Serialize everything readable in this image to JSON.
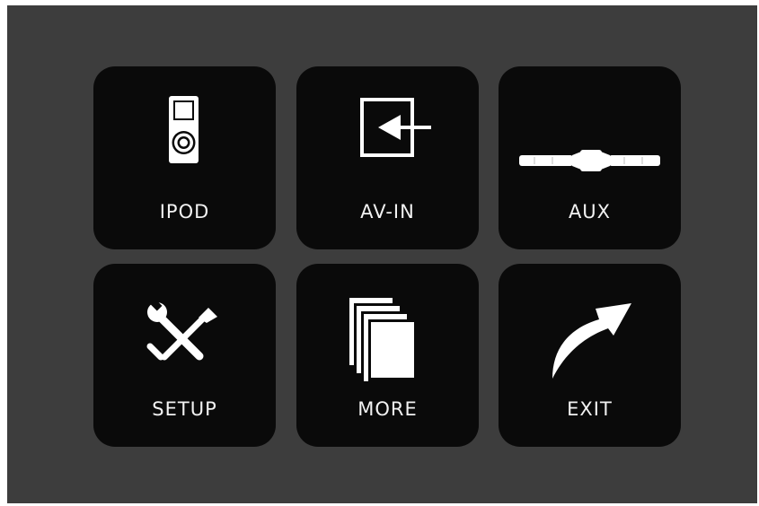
{
  "menu": {
    "tiles": [
      {
        "id": "ipod",
        "label": "IPOD",
        "icon": "ipod-icon"
      },
      {
        "id": "avin",
        "label": "AV-IN",
        "icon": "av-input-icon"
      },
      {
        "id": "aux",
        "label": "AUX",
        "icon": "aux-cable-icon"
      },
      {
        "id": "setup",
        "label": "SETUP",
        "icon": "tools-icon"
      },
      {
        "id": "more",
        "label": "MORE",
        "icon": "pages-icon"
      },
      {
        "id": "exit",
        "label": "EXIT",
        "icon": "exit-arrow-icon"
      }
    ]
  },
  "colors": {
    "screen_background": "#3d3d3d",
    "tile_background": "#0a0a0a",
    "foreground": "#ffffff"
  }
}
